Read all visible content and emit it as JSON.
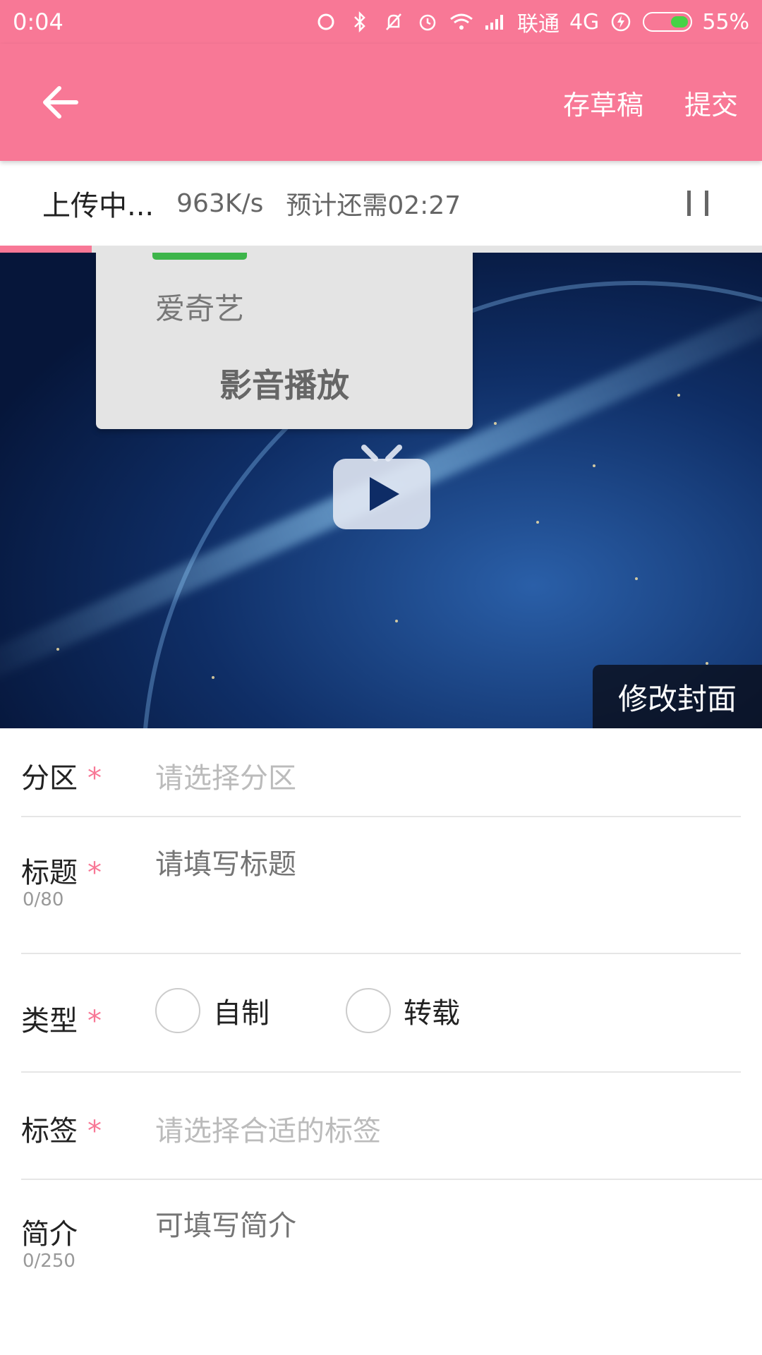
{
  "status_bar": {
    "time": "0:04",
    "carrier": "联通",
    "network": "4G",
    "battery": "55%",
    "battery_level": 0.55,
    "icons": [
      "sync-icon",
      "bluetooth-icon",
      "mute-bell-icon",
      "alarm-icon",
      "wifi-icon",
      "signal-icon",
      "charging-icon",
      "battery-icon"
    ]
  },
  "app_bar": {
    "back_icon": "arrow-left-icon",
    "save_draft": "存草稿",
    "submit": "提交",
    "color": "#f87896"
  },
  "upload": {
    "status": "上传中...",
    "speed": "963K/s",
    "eta": "预计还需02:27",
    "progress": 0.12,
    "pause_icon": "pause-icon"
  },
  "cover": {
    "popup_item1": "爱奇艺",
    "popup_item2": "影音播放",
    "play_icon": "tv-play-icon",
    "edit_cover": "修改封面"
  },
  "form": {
    "section": {
      "label": "分区",
      "required": "*",
      "placeholder": "请选择分区"
    },
    "title": {
      "label": "标题",
      "required": "*",
      "placeholder": "请填写标题",
      "count": "0/80"
    },
    "type": {
      "label": "类型",
      "required": "*",
      "option1": "自制",
      "option2": "转载"
    },
    "tags": {
      "label": "标签",
      "required": "*",
      "placeholder": "请选择合适的标签"
    },
    "intro": {
      "label": "简介",
      "placeholder": "可填写简介",
      "count": "0/250"
    }
  },
  "colors": {
    "accent": "#f87896",
    "required": "#f87896",
    "placeholder": "#bbbbbb"
  }
}
